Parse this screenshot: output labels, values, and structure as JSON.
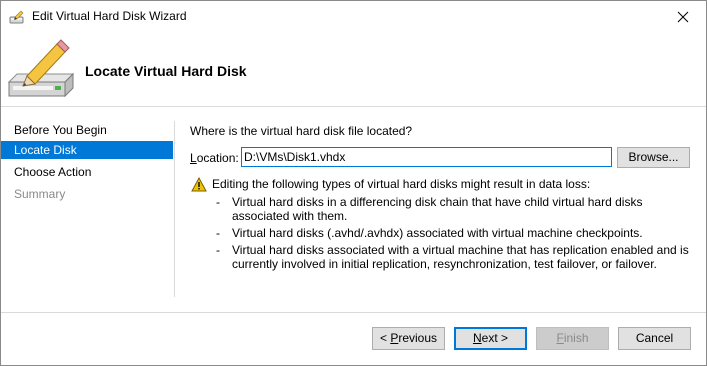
{
  "window": {
    "title": "Edit Virtual Hard Disk Wizard"
  },
  "header": {
    "title": "Locate Virtual Hard Disk"
  },
  "nav": {
    "items": [
      {
        "label": "Before You Begin",
        "state": "normal"
      },
      {
        "label": "Locate Disk",
        "state": "selected"
      },
      {
        "label": "Choose Action",
        "state": "normal"
      },
      {
        "label": "Summary",
        "state": "disabled"
      }
    ]
  },
  "content": {
    "question": "Where is the virtual hard disk file located?",
    "location_label": "Location:",
    "location_value": "D:\\VMs\\Disk1.vhdx",
    "browse_label": "Browse...",
    "warning": "Editing the following types of virtual hard disks might result in data loss:",
    "warning_items": [
      "Virtual hard disks in a differencing disk chain that have child virtual hard disks associated with them.",
      "Virtual hard disks (.avhd/.avhdx) associated with virtual machine checkpoints.",
      "Virtual hard disks associated with a virtual machine that has replication enabled and is currently involved in initial replication, resynchronization, test failover, or failover."
    ]
  },
  "footer": {
    "previous_label": "< Previous",
    "next_label": "Next >",
    "finish_label": "Finish",
    "cancel_label": "Cancel"
  },
  "colors": {
    "accent": "#0078d7",
    "warning": "#f2c200"
  },
  "icons": {
    "title": "disk-wizard-icon",
    "header": "disk-pencil-icon",
    "warning": "warning-icon",
    "close": "close-icon"
  }
}
